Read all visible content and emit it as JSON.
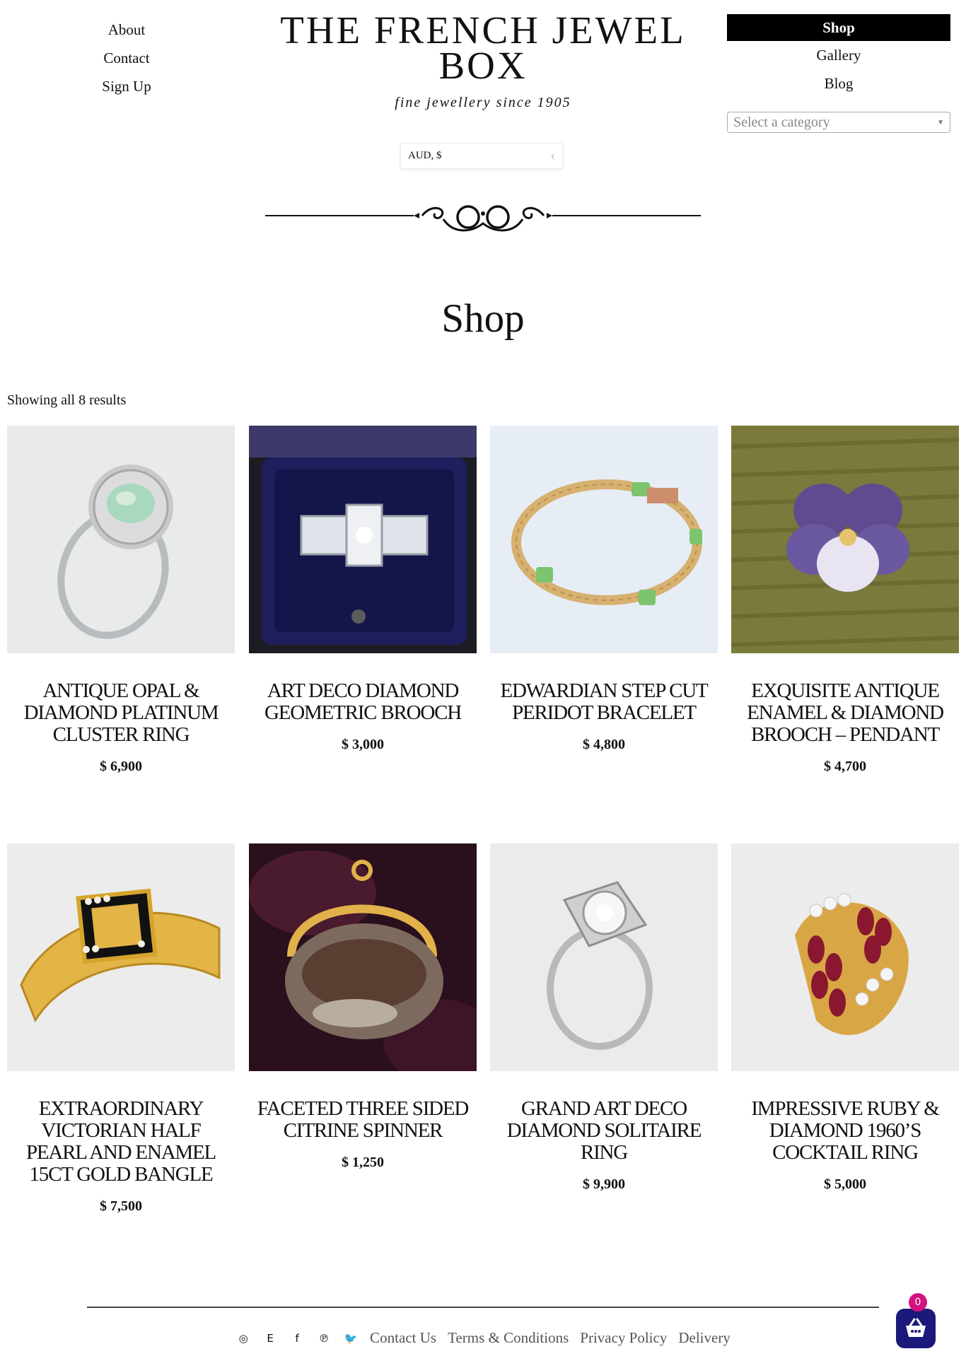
{
  "header": {
    "nav_left": [
      "About",
      "Contact",
      "Sign Up"
    ],
    "brand_title": "THE FRENCH JEWEL BOX",
    "tagline": "fine jewellery since 1905",
    "currency_label": "AUD, $",
    "nav_right": [
      "Shop",
      "Gallery",
      "Blog"
    ],
    "category_placeholder": "Select a category"
  },
  "main": {
    "page_title": "Shop",
    "results_text": "Showing all 8 results",
    "products": [
      {
        "name": "Antique Opal & Diamond Platinum Cluster Ring",
        "price": "$ 6,900"
      },
      {
        "name": "Art Deco Diamond Geometric Brooch",
        "price": "$ 3,000"
      },
      {
        "name": "Edwardian Step Cut Peridot Bracelet",
        "price": "$ 4,800"
      },
      {
        "name": "Exquisite Antique Enamel & Diamond Brooch – Pendant",
        "price": "$ 4,700"
      },
      {
        "name": "Extraordinary Victorian Half Pearl and Enamel 15ct Gold Bangle",
        "price": "$ 7,500"
      },
      {
        "name": "Faceted Three Sided Citrine Spinner",
        "price": "$ 1,250"
      },
      {
        "name": "Grand Art Deco Diamond Solitaire Ring",
        "price": "$ 9,900"
      },
      {
        "name": "Impressive Ruby & Diamond 1960’s Cocktail Ring",
        "price": "$ 5,000"
      }
    ]
  },
  "footer": {
    "social_icons": [
      {
        "icon": "instagram-icon",
        "glyph": "◎"
      },
      {
        "icon": "etsy-icon",
        "glyph": "E"
      },
      {
        "icon": "facebook-icon",
        "glyph": "f"
      },
      {
        "icon": "pinterest-icon",
        "glyph": "℗"
      },
      {
        "icon": "twitter-icon",
        "glyph": "🐦"
      }
    ],
    "links": [
      "Contact Us",
      "Terms & Conditions",
      "Privacy Policy",
      "Delivery"
    ],
    "cart_count": "0"
  },
  "colors": {
    "accent": "#000000",
    "cart_button": "#1b1a7a",
    "cart_badge": "#d4117e"
  }
}
